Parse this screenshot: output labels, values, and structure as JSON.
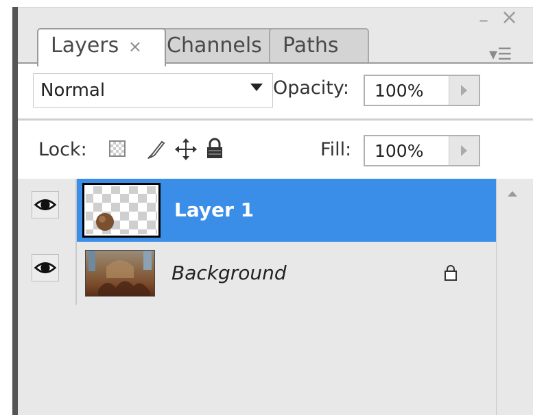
{
  "tabs": {
    "layers_label": "Layers",
    "layers_close": "×",
    "channels_label": "Channels",
    "paths_label": "Paths"
  },
  "window": {
    "minimize": "–",
    "close": "×",
    "menu": "▾☰"
  },
  "blend": {
    "mode": "Normal",
    "opacity_label": "Opacity:",
    "opacity_value": "100%"
  },
  "lock": {
    "label": "Lock:",
    "fill_label": "Fill:",
    "fill_value": "100%"
  },
  "layers": [
    {
      "name": "Layer 1",
      "visible": true,
      "selected": true,
      "locked": false,
      "icon": "eye-icon"
    },
    {
      "name": "Background",
      "visible": true,
      "selected": false,
      "locked": true,
      "icon": "eye-icon"
    }
  ],
  "colors": {
    "selection": "#3b8ee8",
    "panel_bg": "#e8e8e8"
  }
}
